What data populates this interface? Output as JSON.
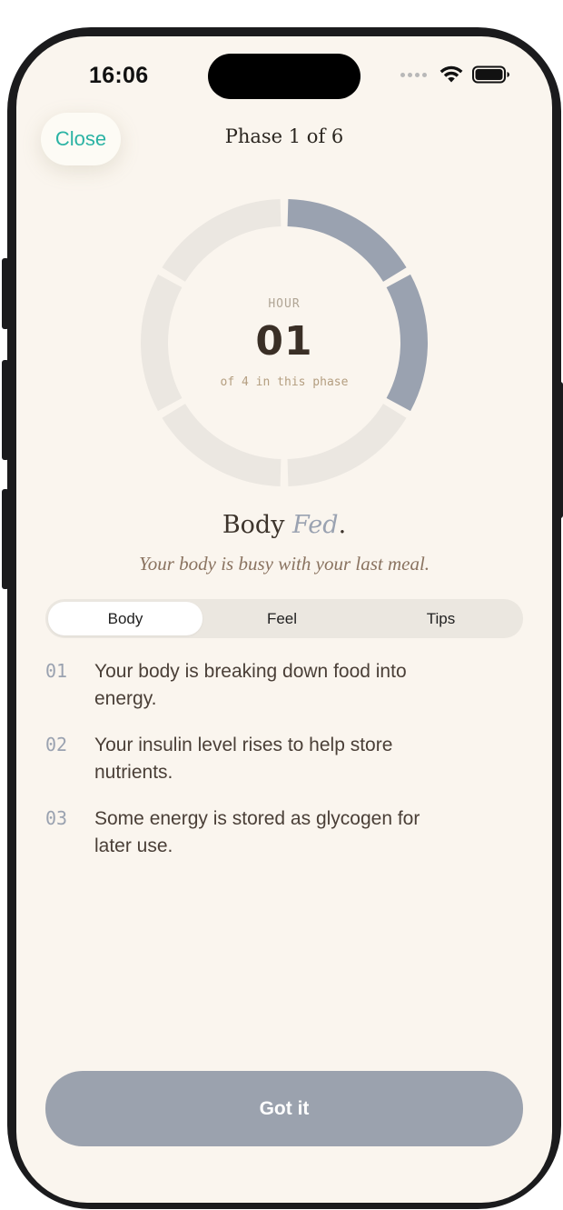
{
  "status_bar": {
    "time": "16:06"
  },
  "header": {
    "close_label": "Close",
    "title": "Phase 1 of 6"
  },
  "progress": {
    "label": "HOUR",
    "value": "01",
    "subtitle": "of 4 in this phase",
    "current_hour": 1,
    "total_hours": 4,
    "fill_fraction": 0.25,
    "colors": {
      "filled": "#9aa2b0",
      "track": "#ebe7e1"
    }
  },
  "summary": {
    "title_main": "Body",
    "title_accent": "Fed",
    "title_period": ".",
    "subtitle": "Your body is busy with your last meal."
  },
  "tabs": [
    {
      "label": "Body",
      "active": true
    },
    {
      "label": "Feel",
      "active": false
    },
    {
      "label": "Tips",
      "active": false
    }
  ],
  "facts": [
    {
      "number": "01",
      "text": "Your body is breaking down food into energy."
    },
    {
      "number": "02",
      "text": "Your insulin level rises to help store nutrients."
    },
    {
      "number": "03",
      "text": "Some energy is stored as glycogen for later use."
    }
  ],
  "footer": {
    "primary_label": "Got it"
  },
  "colors": {
    "background": "#faf5ee",
    "accent_teal": "#2bb3a4",
    "button_gray": "#9ba2ae",
    "text_dark": "#3d342c"
  }
}
